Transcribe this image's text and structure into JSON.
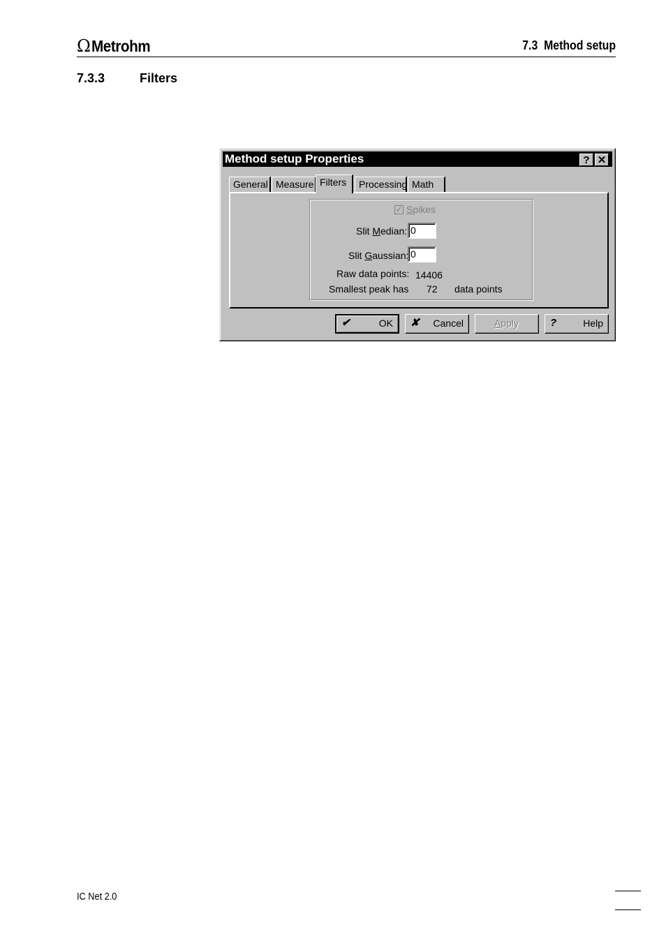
{
  "header": {
    "logo_symbol": "Ω",
    "logo_text": "Metrohm",
    "section_ref": "7.3  Method setup"
  },
  "subsection": {
    "number": "7.3.3",
    "title": "Filters"
  },
  "dialog": {
    "title": "Method setup Properties",
    "title_help": "?",
    "title_close": "✕",
    "tabs": [
      {
        "label": "General"
      },
      {
        "label": "Measure"
      },
      {
        "label": "Filters",
        "active": true
      },
      {
        "label": "Processing"
      },
      {
        "label": "Math"
      }
    ],
    "spikes": {
      "prefix": "",
      "underline": "S",
      "rest": "pikes",
      "checked": true,
      "disabled": true
    },
    "slit_median": {
      "label_pre": "Slit ",
      "label_u": "M",
      "label_post": "edian:",
      "value": "0"
    },
    "slit_gaussian": {
      "label_pre": "Slit ",
      "label_u": "G",
      "label_post": "aussian:",
      "value": "0"
    },
    "raw_points": {
      "label": "Raw data points:",
      "value": "14406"
    },
    "smallest_peak": {
      "label": "Smallest peak has",
      "value": "72",
      "unit": "data points"
    },
    "buttons": {
      "ok": {
        "icon": "✔",
        "label": "OK"
      },
      "cancel": {
        "icon": "✘",
        "label": "Cancel"
      },
      "apply": {
        "label_u": "A",
        "label_rest": "pply"
      },
      "help": {
        "icon": "?",
        "label": "Help"
      }
    }
  },
  "footer": {
    "left": "IC Net 2.0"
  }
}
